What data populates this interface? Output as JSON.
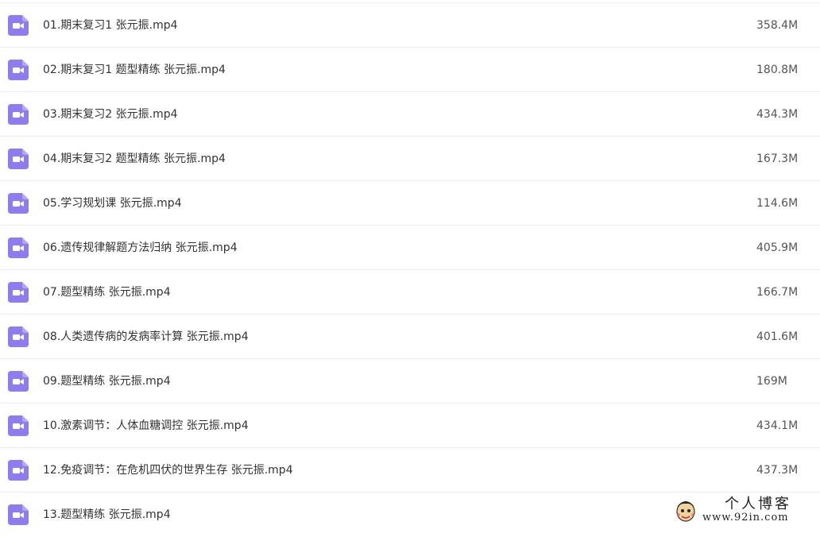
{
  "colors": {
    "icon_bg": "#8e7cf0",
    "icon_fg": "#ffffff",
    "text": "#333333",
    "size_text": "#555555",
    "divider": "#eeeeee"
  },
  "files": [
    {
      "icon": "video-file-icon",
      "name": "01.期末复习1 张元振.mp4",
      "size": "358.4M"
    },
    {
      "icon": "video-file-icon",
      "name": "02.期末复习1 题型精练 张元振.mp4",
      "size": "180.8M"
    },
    {
      "icon": "video-file-icon",
      "name": "03.期末复习2 张元振.mp4",
      "size": "434.3M"
    },
    {
      "icon": "video-file-icon",
      "name": "04.期末复习2 题型精练 张元振.mp4",
      "size": "167.3M"
    },
    {
      "icon": "video-file-icon",
      "name": "05.学习规划课 张元振.mp4",
      "size": "114.6M"
    },
    {
      "icon": "video-file-icon",
      "name": "06.遗传规律解题方法归纳 张元振.mp4",
      "size": "405.9M"
    },
    {
      "icon": "video-file-icon",
      "name": "07.题型精练 张元振.mp4",
      "size": "166.7M"
    },
    {
      "icon": "video-file-icon",
      "name": "08.人类遗传病的发病率计算 张元振.mp4",
      "size": "401.6M"
    },
    {
      "icon": "video-file-icon",
      "name": "09.题型精练 张元振.mp4",
      "size": "169M"
    },
    {
      "icon": "video-file-icon",
      "name": "10.激素调节：人体血糖调控 张元振.mp4",
      "size": "434.1M"
    },
    {
      "icon": "video-file-icon",
      "name": "12.免疫调节：在危机四伏的世界生存 张元振.mp4",
      "size": "437.3M"
    },
    {
      "icon": "video-file-icon",
      "name": "13.题型精练 张元振.mp4",
      "size": ""
    }
  ],
  "watermark": {
    "title": "个人博客",
    "url": "www.92in.com",
    "mascot_icon": "mascot-logo-icon"
  }
}
